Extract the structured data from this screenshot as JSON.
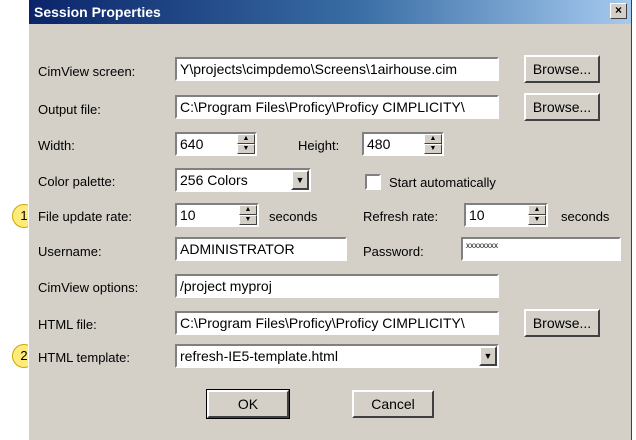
{
  "window": {
    "title": "Session Properties",
    "close": "×"
  },
  "callouts": [
    "1",
    "2"
  ],
  "cimview_screen": {
    "label": "CimView screen:",
    "value": "Y\\projects\\cimpdemo\\Screens\\1airhouse.cim",
    "browse": "Browse..."
  },
  "output_file": {
    "label": "Output file:",
    "value": "C:\\Program Files\\Proficy\\Proficy CIMPLICITY\\",
    "browse": "Browse..."
  },
  "width": {
    "label": "Width:",
    "value": "640"
  },
  "height": {
    "label": "Height:",
    "value": "480"
  },
  "color_palette": {
    "label": "Color palette:",
    "value": "256 Colors"
  },
  "start_auto": {
    "label": "Start automatically",
    "checked": false
  },
  "file_update_rate": {
    "label": "File update rate:",
    "value": "10",
    "unit": "seconds"
  },
  "refresh_rate": {
    "label": "Refresh rate:",
    "value": "10",
    "unit": "seconds"
  },
  "username": {
    "label": "Username:",
    "value": "ADMINISTRATOR"
  },
  "password": {
    "label": "Password:",
    "value": "xxxxxxxx"
  },
  "cimview_options": {
    "label": "CimView options:",
    "value": "/project myproj"
  },
  "html_file": {
    "label": "HTML file:",
    "value": "C:\\Program Files\\Proficy\\Proficy CIMPLICITY\\",
    "browse": "Browse..."
  },
  "html_template": {
    "label": "HTML template:",
    "value": "refresh-IE5-template.html"
  },
  "buttons": {
    "ok": "OK",
    "cancel": "Cancel"
  },
  "icons": {
    "spin_up": "▲",
    "spin_down": "▼",
    "dropdown": "▼"
  },
  "colors": {
    "dialog_bg": "#d4d0c8",
    "title_start": "#0a246a",
    "title_end": "#a6caf0",
    "callout": "#ffeb7a"
  }
}
